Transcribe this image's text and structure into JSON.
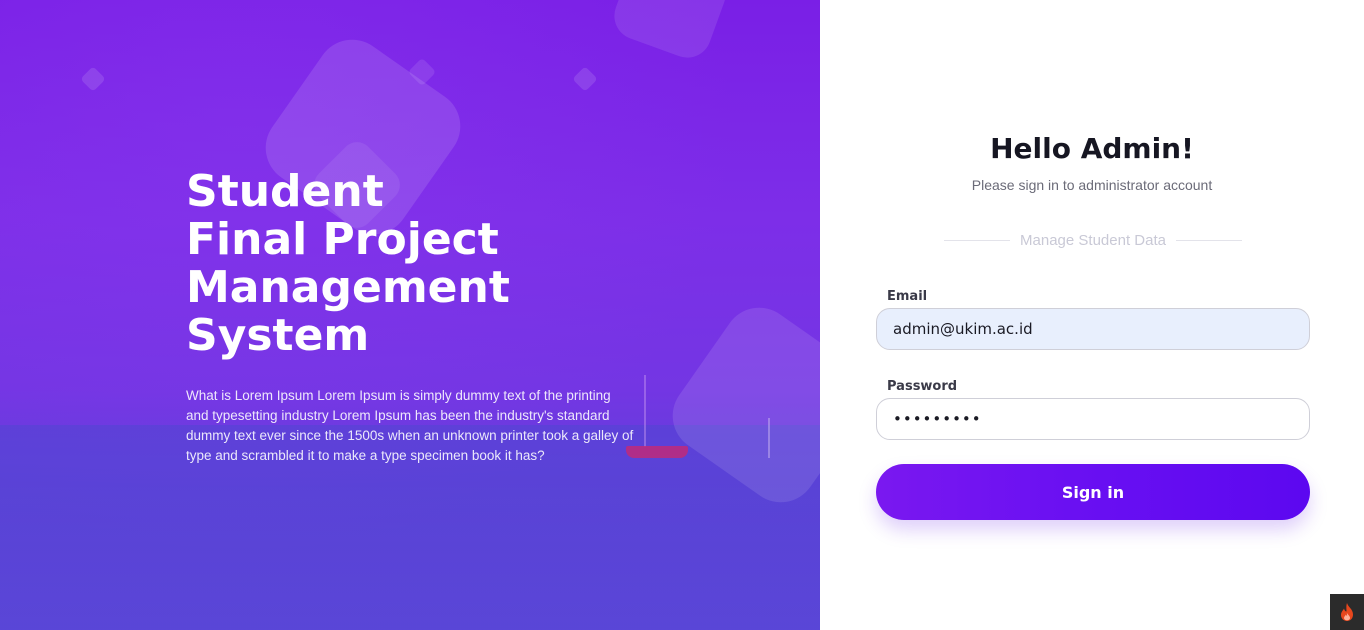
{
  "hero": {
    "title": "Student Final Project Management System",
    "description": "What is Lorem Ipsum Lorem Ipsum is simply dummy text of the printing and typesetting industry Lorem Ipsum has been the industry's standard dummy text ever since the 1500s when an unknown printer took a galley of type and scrambled it to make a type specimen book it has?"
  },
  "login": {
    "greeting": "Hello Admin!",
    "subtitle": "Please sign in to administrator account",
    "divider_text": "Manage Student Data",
    "email_label": "Email",
    "email_value": "admin@ukim.ac.id",
    "password_label": "Password",
    "password_value": "•••••••••",
    "signin_label": "Sign in"
  },
  "debug_toolbar": {
    "icon": "flame-icon"
  },
  "colors": {
    "accent": "#6a10f2",
    "hero_bg": "#7a1fe6",
    "email_field_bg": "#e8effd"
  }
}
